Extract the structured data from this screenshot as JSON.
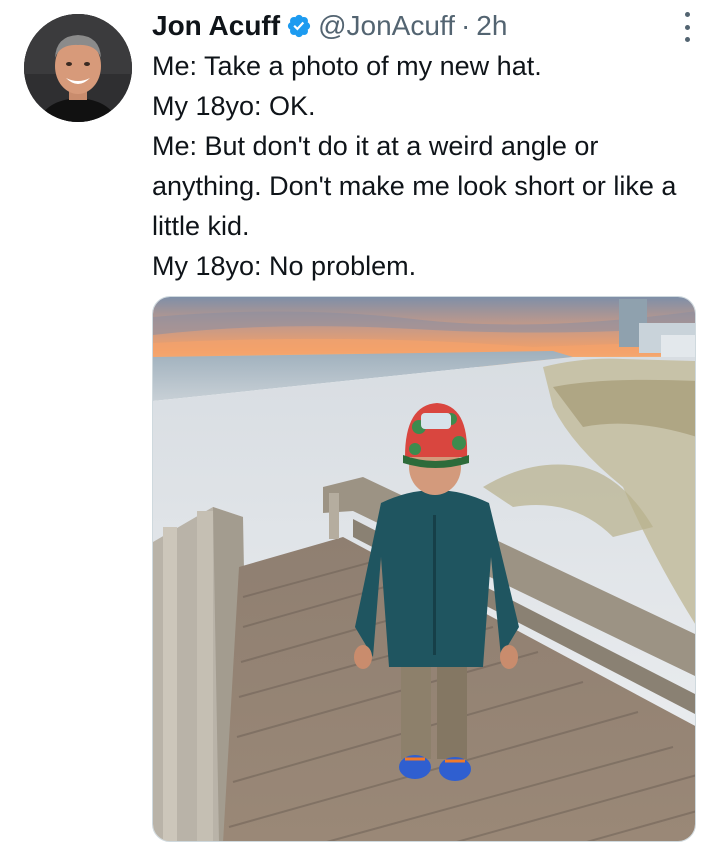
{
  "tweet": {
    "author_name": "Jon Acuff",
    "handle": "@JonAcuff",
    "separator": "·",
    "time": "2h",
    "verified": true,
    "lines": [
      "Me: Take a photo of my new hat.",
      "My 18yo: OK.",
      "Me: But don't do it at a weird angle or anything. Don't make me look short or like a little kid.",
      "My 18yo: No problem."
    ],
    "icons": {
      "verified": "verified-badge-icon",
      "more": "more-options-icon"
    },
    "colors": {
      "text": "#0f1419",
      "secondary": "#536471",
      "verified": "#1d9bf0"
    }
  }
}
